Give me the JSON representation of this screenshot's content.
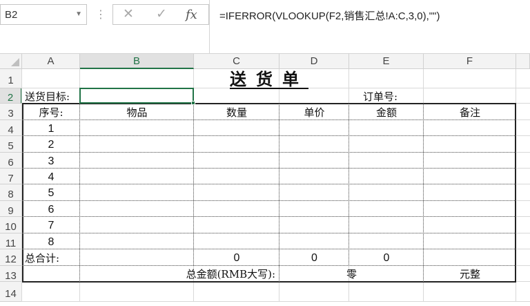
{
  "toolbar": {
    "name_box": "B2",
    "formula": "=IFERROR(VLOOKUP(F2,销售汇总!A:C,3,0),\"\")",
    "icons": [
      "dropdown-icon",
      "cancel-icon",
      "enter-icon",
      "function-icon"
    ]
  },
  "sheet": {
    "columns": [
      "A",
      "B",
      "C",
      "D",
      "E",
      "F"
    ],
    "active_column": "B",
    "rows": [
      "1",
      "2",
      "3",
      "4",
      "5",
      "6",
      "7",
      "8",
      "9",
      "10",
      "11",
      "12",
      "13",
      "14"
    ],
    "active_row": "2"
  },
  "form": {
    "title": "送货单",
    "target_label": "送货目标:",
    "target_value": "",
    "order_no_label": "订单号:",
    "headers": [
      "序号:",
      "物品",
      "数量",
      "单价",
      "金额",
      "备注"
    ],
    "item_numbers": [
      "1",
      "2",
      "3",
      "4",
      "5",
      "6",
      "7",
      "8"
    ],
    "total_label": "总合计:",
    "total_qty": "0",
    "total_price": "0",
    "total_amount": "0",
    "amount_words_label": "总金额(RMB大写):",
    "amount_words_value": "零",
    "amount_words_suffix": "元整"
  },
  "colors": {
    "accent": "#217346",
    "header_bg": "#f3f3f3",
    "gridline": "#d8d8d8"
  }
}
